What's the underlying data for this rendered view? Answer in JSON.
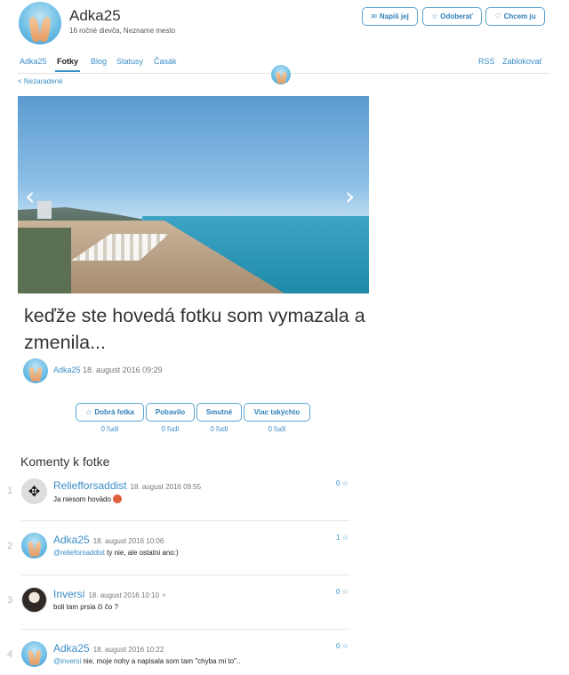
{
  "profile": {
    "name": "Adka25",
    "subtitle": "16 ročné dievča, Nezname mesto"
  },
  "header_buttons": {
    "write": "Napíš jej",
    "unfollow": "Odoberať",
    "want": "Chcem ju"
  },
  "nav": {
    "items": [
      "Adka25",
      "Fotky",
      "Blog",
      "Statusy",
      "Časák"
    ],
    "active": "Fotky",
    "right": [
      "RSS",
      "Zablokovať"
    ]
  },
  "back_link": "< Nezaradené",
  "photo": {
    "prev": "‹",
    "next": "›"
  },
  "post": {
    "title": "keďže ste hovedá fotku som vymazala a zmenila...",
    "author": "Adka25",
    "date": "18. august 2016 09:29"
  },
  "reactions": [
    {
      "label": "Dobrá fotka",
      "icon": "☆",
      "count": "0 ľudí"
    },
    {
      "label": "Pobavilo",
      "icon": "",
      "count": "0 ľudí"
    },
    {
      "label": "Smutné",
      "icon": "",
      "count": "0 ľudí"
    },
    {
      "label": "Viac takýchto",
      "icon": "",
      "count": "0 ľudí"
    }
  ],
  "comments_title": "Komenty k fotke",
  "comments": [
    {
      "num": "1",
      "author": "Reliefforsaddist",
      "date": "18. august 2016 09:55",
      "mention": "",
      "text": "Ja niesom hovädo",
      "score": "0 ☆",
      "avatar": "winged-skull-avatar"
    },
    {
      "num": "2",
      "author": "Adka25",
      "date": "18. august 2016 10:06",
      "mention": "@relieforsaddist",
      "text": " ty nie, ale ostatni ano:)",
      "score": "1 ☆",
      "avatar": "feet-avatar"
    },
    {
      "num": "3",
      "author": "Inversi",
      "date": "18. august 2016 10:10",
      "mention": "",
      "text": "boli tam prsia či čo ?",
      "score": "0 ☆",
      "avatar": "face-avatar"
    },
    {
      "num": "4",
      "author": "Adka25",
      "date": "18. august 2016 10:22",
      "mention": "@inversi",
      "text": " nie, moje nohy a napisala som tam \"chyba mi to\"..",
      "score": "0 ☆",
      "avatar": "feet-avatar"
    }
  ],
  "icons": {
    "write": "envelope-icon",
    "unfollow": "star-icon",
    "want": "heart-icon"
  },
  "colors": {
    "accent": "#3b8ec7",
    "button_border": "#5ea3cf",
    "text": "#333333"
  }
}
